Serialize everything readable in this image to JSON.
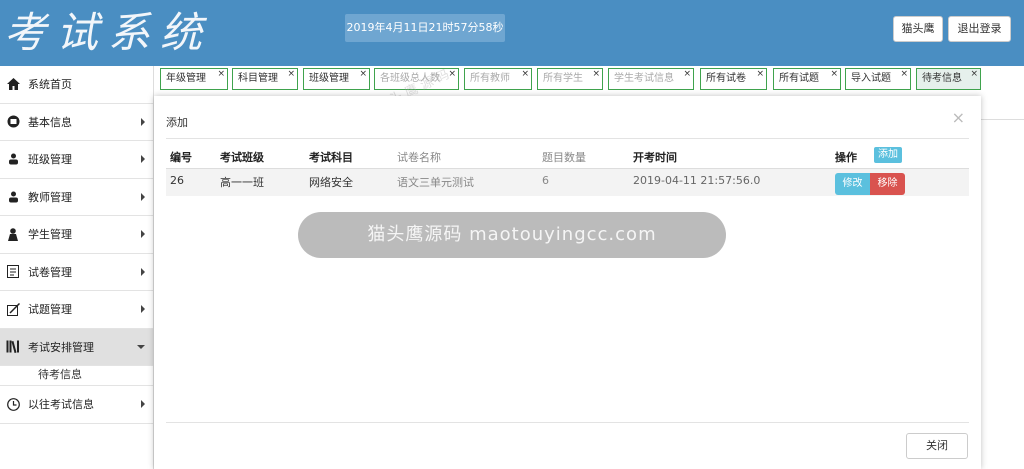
{
  "header": {
    "logo": "考试系统",
    "clock": "2019年4月11日21时57分58秒",
    "user_button": "猫头鹰",
    "logout_button": "退出登录"
  },
  "sidebar": {
    "items": [
      {
        "label": "系统首页",
        "icon": "home-icon"
      },
      {
        "label": "基本信息",
        "icon": "info-icon"
      },
      {
        "label": "班级管理",
        "icon": "group-icon"
      },
      {
        "label": "教师管理",
        "icon": "teacher-icon"
      },
      {
        "label": "学生管理",
        "icon": "student-icon"
      },
      {
        "label": "试卷管理",
        "icon": "paper-icon"
      },
      {
        "label": "试题管理",
        "icon": "question-icon"
      },
      {
        "label": "考试安排管理",
        "icon": "books-icon"
      },
      {
        "label": "以往考试信息",
        "icon": "clock-icon"
      }
    ],
    "subitem": "待考信息"
  },
  "tabs": [
    {
      "label": "年级管理"
    },
    {
      "label": "科目管理"
    },
    {
      "label": "班级管理"
    },
    {
      "label": "各班级总人数"
    },
    {
      "label": "所有教师"
    },
    {
      "label": "所有学生"
    },
    {
      "label": "学生考试信息"
    },
    {
      "label": "所有试卷"
    },
    {
      "label": "所有试题"
    },
    {
      "label": "导入试题"
    },
    {
      "label": "待考信息"
    }
  ],
  "modal": {
    "title": "添加",
    "close_glyph": "×",
    "columns": [
      "编号",
      "考试班级",
      "考试科目",
      "试卷名称",
      "题目数量",
      "开考时间",
      "操作"
    ],
    "add_button": "添加",
    "row": {
      "id": "26",
      "class": "高一一班",
      "subject": "网络安全",
      "paper": "语文三单元测试",
      "count": "6",
      "time": "2019-04-11 21:57:56.0"
    },
    "edit_button": "修改",
    "remove_button": "移除",
    "close_button": "关闭"
  },
  "watermark": {
    "pill": "猫头鹰源码 maotouyingcc.com",
    "small": "猫 头 鹰 源 码"
  },
  "colors": {
    "header": "#4a8ec2",
    "tab_border": "#3fa34d",
    "info": "#5bc0de",
    "danger": "#d9534f"
  }
}
